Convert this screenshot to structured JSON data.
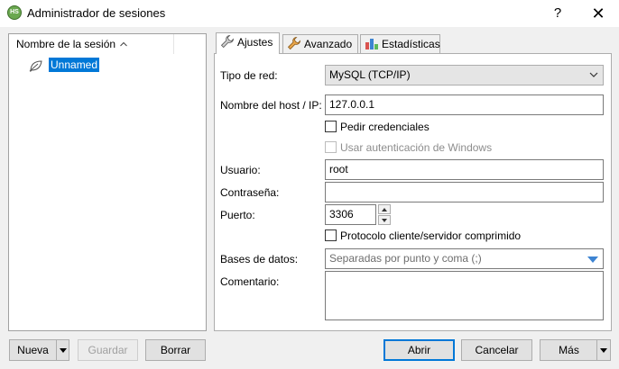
{
  "window": {
    "title": "Administrador de sesiones",
    "app_icon": "HS",
    "help_glyph": "?",
    "close_glyph": "✕"
  },
  "tree": {
    "header": "Nombre de la sesión",
    "sessions": [
      {
        "name": "Unnamed",
        "selected": true
      }
    ]
  },
  "tabs": [
    {
      "label": "Ajustes",
      "icon": "wrench-icon",
      "active": true
    },
    {
      "label": "Avanzado",
      "icon": "wrench-icon",
      "active": false
    },
    {
      "label": "Estadísticas",
      "icon": "bar-chart-icon",
      "active": false
    }
  ],
  "form": {
    "network_type": {
      "label": "Tipo de red:",
      "value": "MySQL (TCP/IP)"
    },
    "hostname": {
      "label": "Nombre del host / IP:",
      "value": "127.0.0.1"
    },
    "prompt_credentials": {
      "label": "Pedir credenciales",
      "checked": false
    },
    "windows_auth": {
      "label": "Usar autenticación de Windows",
      "checked": false,
      "enabled": false
    },
    "user": {
      "label": "Usuario:",
      "value": "root"
    },
    "password": {
      "label": "Contraseña:",
      "value": ""
    },
    "port": {
      "label": "Puerto:",
      "value": "3306"
    },
    "compressed_protocol": {
      "label": "Protocolo cliente/servidor comprimido",
      "checked": false
    },
    "databases": {
      "label": "Bases de datos:",
      "placeholder": "Separadas por punto y coma (;)"
    },
    "comment": {
      "label": "Comentario:",
      "value": ""
    }
  },
  "buttons": {
    "new": "Nueva",
    "save": "Guardar",
    "delete": "Borrar",
    "open": "Abrir",
    "cancel": "Cancelar",
    "more": "Más"
  },
  "colors": {
    "selection": "#0078d7",
    "default_button_border": "#0078d7",
    "databases_arrow": "#3d84d2"
  }
}
